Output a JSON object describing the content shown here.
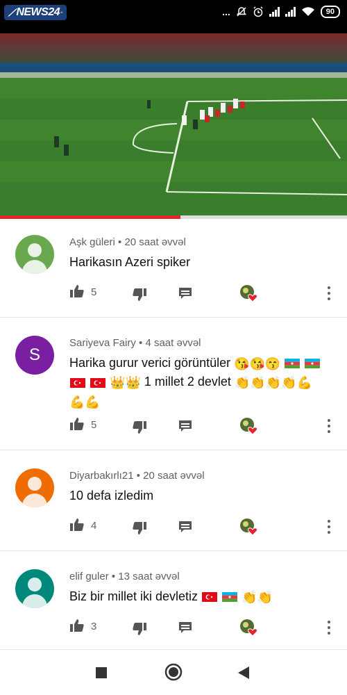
{
  "status_bar": {
    "logo": "NEWS24",
    "dots": "...",
    "battery": "90"
  },
  "video": {
    "progress": 0.52
  },
  "comments": [
    {
      "author": "Aşk güleri",
      "time": "20 saat əvvəl",
      "text": "Harikasın Azeri spiker",
      "likes": "5",
      "avatar_color": "#6aa84f",
      "avatar_letter": ""
    },
    {
      "author": "Sariyeva Fairy",
      "time": "4 saat əvvəl",
      "text": "Harika gurur verici görüntüler",
      "text2": "1 millet 2 devlet",
      "likes": "5",
      "avatar_color": "#7b1fa2",
      "avatar_letter": "S"
    },
    {
      "author": "Diyarbakırlı21",
      "time": "20 saat əvvəl",
      "text": "10 defa izledim",
      "likes": "4",
      "avatar_color": "#ef6c00",
      "avatar_letter": ""
    },
    {
      "author": "elif guler",
      "time": "13 saat əvvəl",
      "text": "Biz bir millet iki devletiz",
      "likes": "3",
      "avatar_color": "#00897b",
      "avatar_letter": ""
    }
  ],
  "icons": {
    "like": "thumb-up-icon",
    "dislike": "thumb-down-icon",
    "reply": "reply-icon",
    "creator_heart": "creator-heart-icon",
    "menu": "more-vert-icon",
    "nav_recents": "square-icon",
    "nav_home": "circle-icon",
    "nav_back": "back-triangle-icon"
  },
  "colors": {
    "accent": "#e0262b",
    "meta_text": "#606060"
  }
}
